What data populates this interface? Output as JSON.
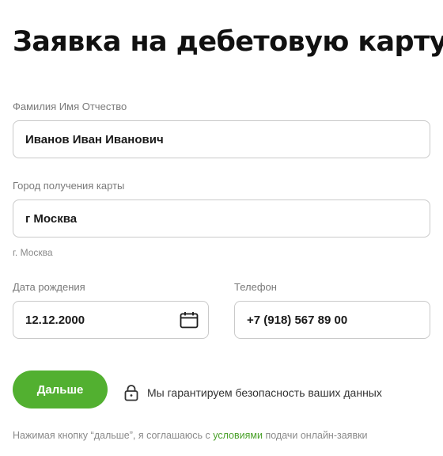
{
  "page": {
    "title": "Заявка на дебетовую карту"
  },
  "form": {
    "full_name": {
      "label": "Фамилия Имя Отчество",
      "value": "Иванов Иван Иванович"
    },
    "city": {
      "label": "Город получения карты",
      "value": "г Москва",
      "hint": "г. Москва"
    },
    "birth_date": {
      "label": "Дата рождения",
      "value": "12.12.2000",
      "icon": "calendar-icon"
    },
    "phone": {
      "label": "Телефон",
      "value": "+7 (918) 567 89 00"
    }
  },
  "actions": {
    "next_label": "Дальше",
    "security_text": "Мы гарантируем безопасность ваших данных",
    "security_icon": "lock-icon"
  },
  "consent": {
    "before": "Нажимая кнопку “дальше”, я соглашаюсь с ",
    "link": "условиями",
    "after": " подачи онлайн-заявки"
  },
  "colors": {
    "accent": "#52b030",
    "link": "#4aa12a",
    "border": "#c9c9c9",
    "muted_text": "#7a7a7a"
  }
}
